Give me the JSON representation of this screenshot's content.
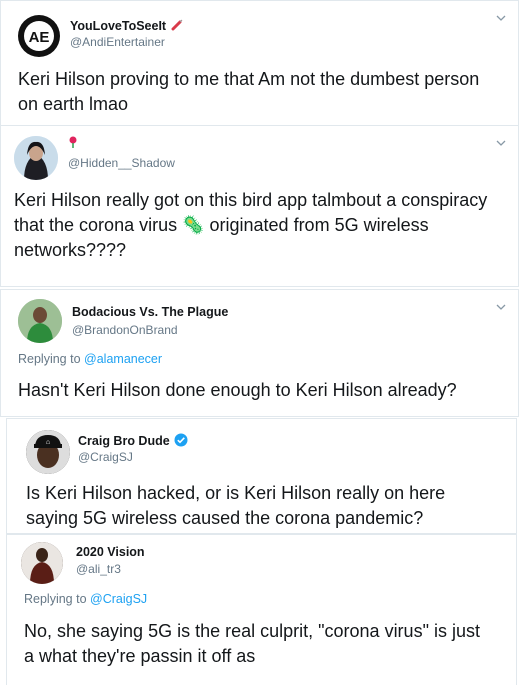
{
  "tweets": [
    {
      "name": "YouLoveToSeeIt",
      "handle": "@AndiEntertainer",
      "avatar_text": "AE",
      "text": "Keri Hilson proving to me that Am not the dumbest person on earth lmao"
    },
    {
      "name": "",
      "handle": "@Hidden__Shadow",
      "text": "Keri Hilson really got on this bird app  talmbout a conspiracy that the corona virus 🦠 originated from 5G wireless networks????"
    },
    {
      "name": "Bodacious Vs. The Plague",
      "handle": "@BrandonOnBrand",
      "replying_label": "Replying to",
      "replying_to": "@alamanecer",
      "text": "Hasn't Keri Hilson done enough to Keri Hilson already?"
    },
    {
      "name": "Craig Bro Dude",
      "handle": "@CraigSJ",
      "verified": true,
      "text": "Is Keri Hilson hacked, or is Keri Hilson really on here saying 5G wireless caused the corona pandemic?"
    },
    {
      "name": "2020 Vision",
      "handle": "@ali_tr3",
      "replying_label": "Replying to",
      "replying_to": "@CraigSJ",
      "text": "No, she saying 5G is the real culprit, \"corona virus\"  is just a what they're passin it off as"
    }
  ]
}
